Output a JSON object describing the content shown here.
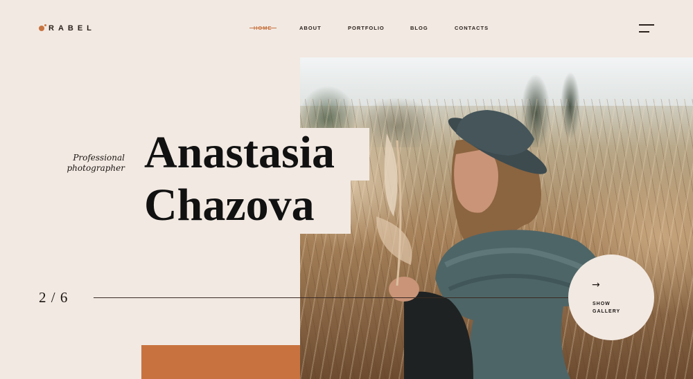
{
  "brand": {
    "logo_text": "RABEL",
    "accent": "#c8733f"
  },
  "nav": {
    "items": [
      {
        "label": "HOME",
        "active": true
      },
      {
        "label": "ABOUT",
        "active": false
      },
      {
        "label": "PORTFOLIO",
        "active": false
      },
      {
        "label": "BLOG",
        "active": false
      },
      {
        "label": "CONTACTS",
        "active": false
      }
    ]
  },
  "hero": {
    "subtitle_line1": "Professional",
    "subtitle_line2": "photographer",
    "name_first": "Anastasia",
    "name_last": "Chazova"
  },
  "slider": {
    "current": "2",
    "separator": "/",
    "total": "6"
  },
  "gallery": {
    "label_line1": "SHOW",
    "label_line2": "GALLERY"
  },
  "icons": {
    "menu": "hamburger-icon",
    "arrow": "arrow-right-icon"
  }
}
